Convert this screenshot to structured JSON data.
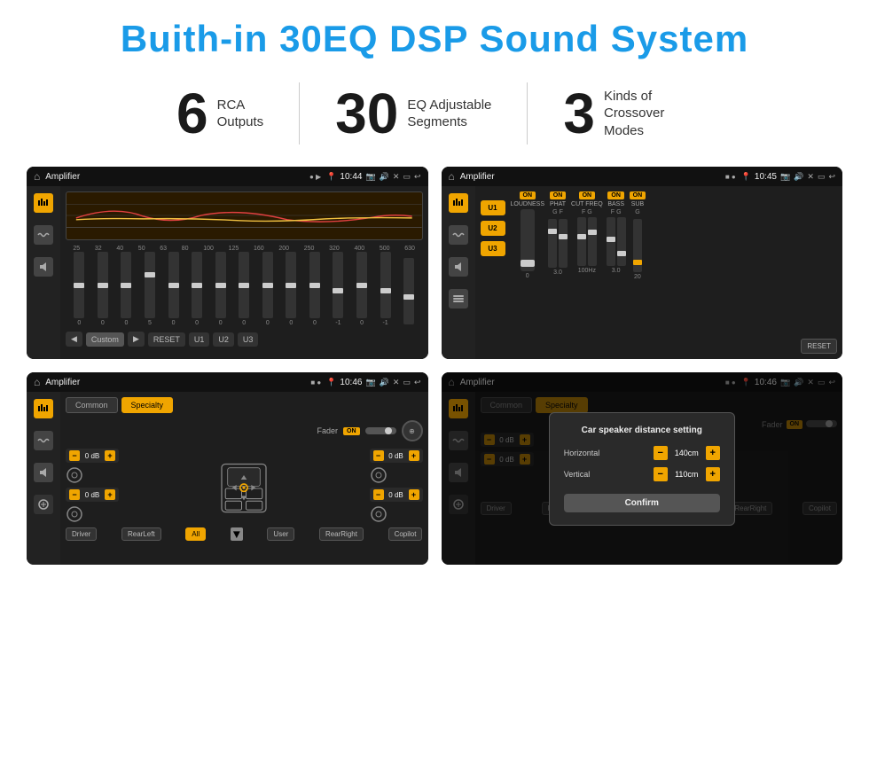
{
  "title": "Buith-in 30EQ DSP Sound System",
  "stats": [
    {
      "number": "6",
      "label_line1": "RCA",
      "label_line2": "Outputs"
    },
    {
      "number": "30",
      "label_line1": "EQ Adjustable",
      "label_line2": "Segments"
    },
    {
      "number": "3",
      "label_line1": "Kinds of",
      "label_line2": "Crossover Modes"
    }
  ],
  "screens": [
    {
      "id": "screen1",
      "status_title": "Amplifier",
      "status_time": "10:44",
      "type": "eq"
    },
    {
      "id": "screen2",
      "status_title": "Amplifier",
      "status_time": "10:45",
      "type": "amp"
    },
    {
      "id": "screen3",
      "status_title": "Amplifier",
      "status_time": "10:46",
      "type": "common"
    },
    {
      "id": "screen4",
      "status_title": "Amplifier",
      "status_time": "10:46",
      "type": "dialog"
    }
  ],
  "eq": {
    "frequencies": [
      "25",
      "32",
      "40",
      "50",
      "63",
      "80",
      "100",
      "125",
      "160",
      "200",
      "250",
      "320",
      "400",
      "500",
      "630"
    ],
    "values": [
      "0",
      "0",
      "0",
      "5",
      "0",
      "0",
      "0",
      "0",
      "0",
      "0",
      "0",
      "-1",
      "0",
      "-1",
      ""
    ],
    "preset": "Custom",
    "buttons": [
      "RESET",
      "U1",
      "U2",
      "U3"
    ]
  },
  "amp_screen": {
    "presets": [
      "U1",
      "U2",
      "U3"
    ],
    "reset_label": "RESET",
    "channels": [
      "LOUDNESS",
      "PHAT",
      "CUT FREQ",
      "BASS",
      "SUB"
    ]
  },
  "common_screen": {
    "tabs": [
      "Common",
      "Specialty"
    ],
    "active_tab": "Specialty",
    "fader_label": "Fader",
    "fader_on": "ON",
    "controls": [
      "0 dB",
      "0 dB",
      "0 dB",
      "0 dB"
    ],
    "bottom_buttons": [
      "Driver",
      "RearLeft",
      "All",
      "User",
      "RearRight",
      "Copilot"
    ]
  },
  "dialog": {
    "title": "Car speaker distance setting",
    "horizontal_label": "Horizontal",
    "horizontal_value": "140cm",
    "vertical_label": "Vertical",
    "vertical_value": "110cm",
    "confirm_label": "Confirm",
    "right_db1": "0 dB",
    "right_db2": "0 dB"
  }
}
